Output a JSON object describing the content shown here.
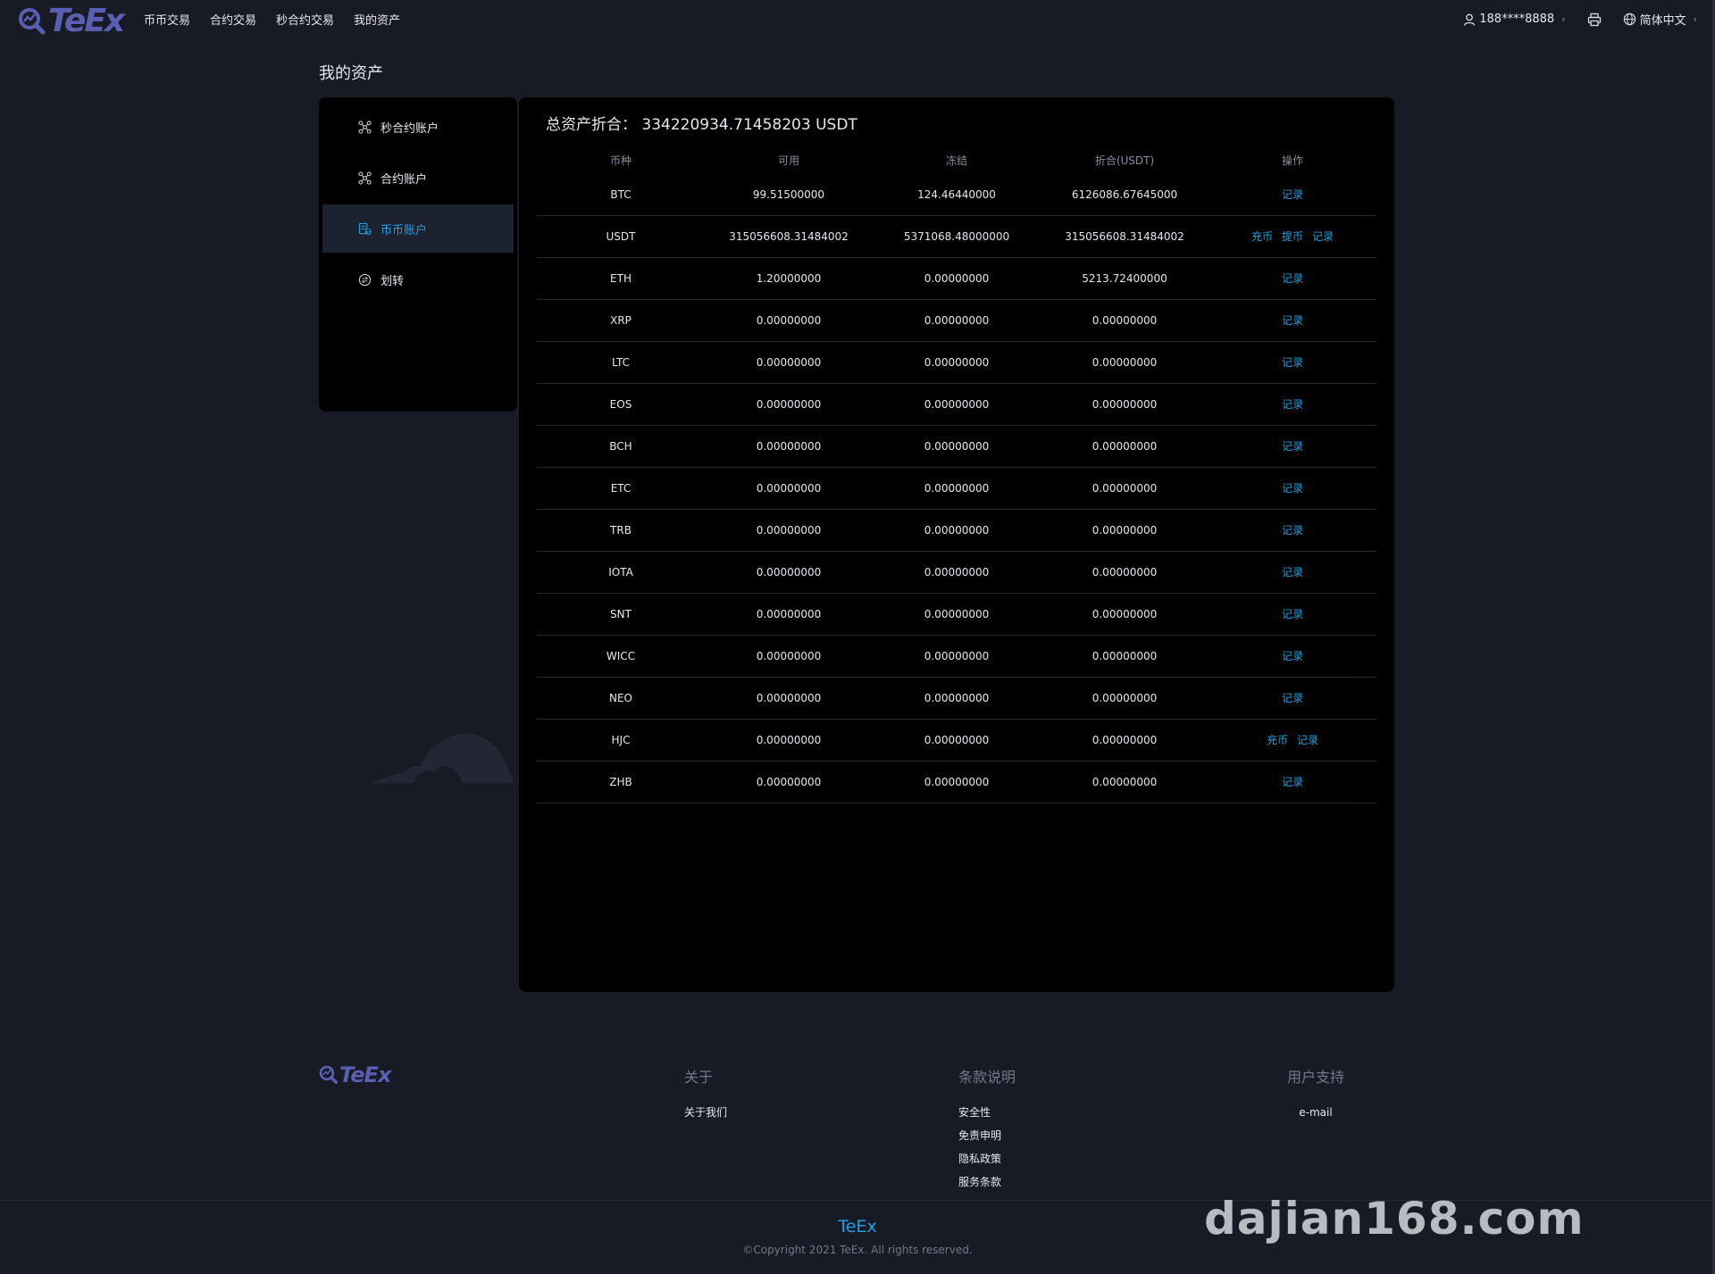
{
  "brand": "TeEx",
  "nav": [
    "币币交易",
    "合约交易",
    "秒合约交易",
    "我的资产"
  ],
  "header_right": {
    "user": "188****8888",
    "language": "简体中文"
  },
  "page_title": "我的资产",
  "sidebar": [
    {
      "label": "秒合约账户",
      "icon": "network-icon",
      "active": false
    },
    {
      "label": "合约账户",
      "icon": "network-icon",
      "active": false
    },
    {
      "label": "币币账户",
      "icon": "wallet-icon",
      "active": true
    },
    {
      "label": "划转",
      "icon": "transfer-icon",
      "active": false
    }
  ],
  "total": {
    "label": "总资产折合：",
    "value": "334220934.71458203 USDT"
  },
  "table": {
    "headers": [
      "币种",
      "可用",
      "冻结",
      "折合(USDT)",
      "操作"
    ],
    "rows": [
      {
        "coin": "BTC",
        "available": "99.51500000",
        "frozen": "124.46440000",
        "usdt": "6126086.67645000",
        "actions": [
          "记录"
        ]
      },
      {
        "coin": "USDT",
        "available": "315056608.31484002",
        "frozen": "5371068.48000000",
        "usdt": "315056608.31484002",
        "actions": [
          "充币",
          "提币",
          "记录"
        ]
      },
      {
        "coin": "ETH",
        "available": "1.20000000",
        "frozen": "0.00000000",
        "usdt": "5213.72400000",
        "actions": [
          "记录"
        ]
      },
      {
        "coin": "XRP",
        "available": "0.00000000",
        "frozen": "0.00000000",
        "usdt": "0.00000000",
        "actions": [
          "记录"
        ]
      },
      {
        "coin": "LTC",
        "available": "0.00000000",
        "frozen": "0.00000000",
        "usdt": "0.00000000",
        "actions": [
          "记录"
        ]
      },
      {
        "coin": "EOS",
        "available": "0.00000000",
        "frozen": "0.00000000",
        "usdt": "0.00000000",
        "actions": [
          "记录"
        ]
      },
      {
        "coin": "BCH",
        "available": "0.00000000",
        "frozen": "0.00000000",
        "usdt": "0.00000000",
        "actions": [
          "记录"
        ]
      },
      {
        "coin": "ETC",
        "available": "0.00000000",
        "frozen": "0.00000000",
        "usdt": "0.00000000",
        "actions": [
          "记录"
        ]
      },
      {
        "coin": "TRB",
        "available": "0.00000000",
        "frozen": "0.00000000",
        "usdt": "0.00000000",
        "actions": [
          "记录"
        ]
      },
      {
        "coin": "IOTA",
        "available": "0.00000000",
        "frozen": "0.00000000",
        "usdt": "0.00000000",
        "actions": [
          "记录"
        ]
      },
      {
        "coin": "SNT",
        "available": "0.00000000",
        "frozen": "0.00000000",
        "usdt": "0.00000000",
        "actions": [
          "记录"
        ]
      },
      {
        "coin": "WICC",
        "available": "0.00000000",
        "frozen": "0.00000000",
        "usdt": "0.00000000",
        "actions": [
          "记录"
        ]
      },
      {
        "coin": "NEO",
        "available": "0.00000000",
        "frozen": "0.00000000",
        "usdt": "0.00000000",
        "actions": [
          "记录"
        ]
      },
      {
        "coin": "HJC",
        "available": "0.00000000",
        "frozen": "0.00000000",
        "usdt": "0.00000000",
        "actions": [
          "充币",
          "记录"
        ]
      },
      {
        "coin": "ZHB",
        "available": "0.00000000",
        "frozen": "0.00000000",
        "usdt": "0.00000000",
        "actions": [
          "记录"
        ]
      }
    ]
  },
  "footer": {
    "columns": [
      {
        "title": "关于",
        "links": [
          "关于我们"
        ]
      },
      {
        "title": "条款说明",
        "links": [
          "安全性",
          "免责申明",
          "隐私政策",
          "服务条款"
        ]
      },
      {
        "title": "用户支持",
        "links": [
          "e-mail"
        ]
      }
    ],
    "brand": "TeEx",
    "copyright": "©Copyright 2021 TeEx. All rights reserved."
  },
  "watermark": "dajian168.com",
  "colors": {
    "background": "#181b25",
    "panel": "#000000",
    "accent": "#21a1e0",
    "logo": "#5a5fb2"
  }
}
